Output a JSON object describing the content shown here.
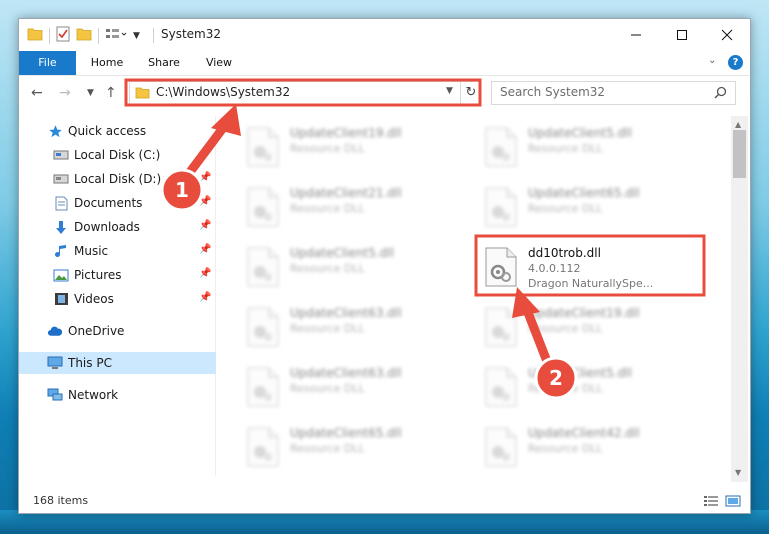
{
  "window": {
    "title": "System32"
  },
  "ribbon": {
    "tabs": [
      {
        "label": "File"
      },
      {
        "label": "Home"
      },
      {
        "label": "Share"
      },
      {
        "label": "View"
      }
    ]
  },
  "address": {
    "path": "C:\\Windows\\System32"
  },
  "search": {
    "placeholder": "Search System32"
  },
  "sidebar": {
    "items": [
      {
        "label": "Quick access"
      },
      {
        "label": "Local Disk (C:)"
      },
      {
        "label": "Local Disk (D:)"
      },
      {
        "label": "Documents"
      },
      {
        "label": "Downloads"
      },
      {
        "label": "Music"
      },
      {
        "label": "Pictures"
      },
      {
        "label": "Videos"
      },
      {
        "label": "OneDrive"
      },
      {
        "label": "This PC"
      },
      {
        "label": "Network"
      }
    ]
  },
  "files": {
    "left": [
      {
        "name": "UpdateClient19.dll",
        "type": "Resource DLL"
      },
      {
        "name": "UpdateClient21.dll",
        "type": "Resource DLL"
      },
      {
        "name": "UpdateClient5.dll",
        "type": "Resource DLL"
      },
      {
        "name": "UpdateClient63.dll",
        "type": "Resource DLL"
      },
      {
        "name": "UpdateClient63.dll",
        "type": "Resource DLL"
      },
      {
        "name": "UpdateClient65.dll",
        "type": "Resource DLL"
      }
    ],
    "right": [
      {
        "name": "UpdateClient5.dll",
        "type": "Resource DLL"
      },
      {
        "name": "UpdateClient65.dll",
        "type": "Resource DLL"
      },
      {
        "name": "dd10trob.dll",
        "version": "4.0.0.112",
        "company": "Dragon NaturallySpe..."
      },
      {
        "name": "UpdateClient19.dll",
        "type": "Resource DLL"
      },
      {
        "name": "UpdateClient5.dll",
        "type": "Resource DLL"
      },
      {
        "name": "UpdateClient42.dll",
        "type": "Resource DLL"
      }
    ]
  },
  "status": {
    "count": "168 items"
  },
  "annotations": {
    "step1": "1",
    "step2": "2",
    "color": "#e84c3d"
  }
}
